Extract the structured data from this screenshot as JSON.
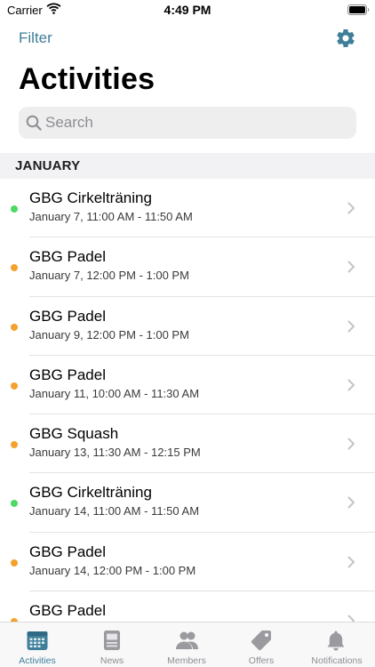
{
  "status_bar": {
    "carrier": "Carrier",
    "time": "4:49 PM"
  },
  "nav": {
    "filter_label": "Filter",
    "settings_icon": "gear-icon",
    "title": "Activities"
  },
  "search": {
    "placeholder": "Search",
    "value": ""
  },
  "sections": [
    {
      "header": "JANUARY",
      "items": [
        {
          "title": "GBG Cirkelträning",
          "subtitle": "January 7, 11:00 AM - 11:50 AM",
          "status_color": "#4cd964"
        },
        {
          "title": "GBG Padel",
          "subtitle": "January 7, 12:00 PM - 1:00 PM",
          "status_color": "#f5a12f"
        },
        {
          "title": "GBG Padel",
          "subtitle": "January 9, 12:00 PM - 1:00 PM",
          "status_color": "#f5a12f"
        },
        {
          "title": "GBG Padel",
          "subtitle": "January 11, 10:00 AM - 11:30 AM",
          "status_color": "#f5a12f"
        },
        {
          "title": "GBG Squash",
          "subtitle": "January 13, 11:30 AM - 12:15 PM",
          "status_color": "#f5a12f"
        },
        {
          "title": "GBG Cirkelträning",
          "subtitle": "January 14, 11:00 AM - 11:50 AM",
          "status_color": "#4cd964"
        },
        {
          "title": "GBG Padel",
          "subtitle": "January 14, 12:00 PM - 1:00 PM",
          "status_color": "#f5a12f"
        },
        {
          "title": "GBG Padel",
          "subtitle": "",
          "status_color": "#f5a12f"
        }
      ]
    }
  ],
  "tab_bar": {
    "tabs": [
      {
        "label": "Activities",
        "icon": "calendar-icon",
        "active": true
      },
      {
        "label": "News",
        "icon": "newspaper-icon",
        "active": false
      },
      {
        "label": "Members",
        "icon": "members-icon",
        "active": false
      },
      {
        "label": "Offers",
        "icon": "tag-icon",
        "active": false
      },
      {
        "label": "Notifications",
        "icon": "bell-icon",
        "active": false
      }
    ]
  },
  "colors": {
    "accent": "#3f7f9a",
    "inactive": "#8e8e93",
    "status_green": "#4cd964",
    "status_orange": "#f5a12f"
  }
}
